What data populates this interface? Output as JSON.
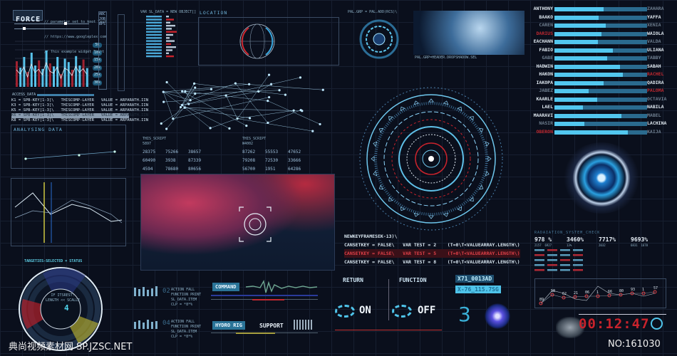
{
  "force": {
    "title": "FORCE",
    "notes": [
      "// parameter set to knot Test",
      "// https://www.googleplex.com",
      "// This example widget Right"
    ],
    "side_tags": [
      "ABC",
      "JOB",
      "BPS"
    ],
    "buttons": [
      "5k",
      "10k",
      "15k",
      "20k",
      "25k",
      "30k"
    ],
    "bars": [
      0.6,
      0.45,
      0.7,
      0.35,
      0.8,
      0.5,
      0.62,
      0.42,
      0.85,
      0.55,
      0.48,
      0.7,
      0.3,
      0.66,
      0.58,
      0.4,
      0.72,
      0.5,
      0.64,
      0.44
    ]
  },
  "access": {
    "title": "ACCESS_DATA",
    "rows": [
      "K1 = SPB-KEY[1-3]\\   THISCOMP-LAYER   VALUE = ARPARATH.IIN",
      "K3 = SPB-KEY[1-3]\\   THISCOMP-LAYER   VALUE = ARPARATH.IIN",
      "K5 = SPB-KEY[1-3]\\   THISCOMP-LAYER   VALUE = ARPARATH.IIN",
      "K6 = SPB-KEY[1-3]\\   THISCOMP-LAYER   VALUE = ARPARATH.IIN",
      "K8 = SPB-KEY[1-3]\\   THISCOMP-LAYER   VALUE = ARPARATH.IIN"
    ],
    "highlight_row": 3
  },
  "analysing": {
    "title": "ANALYSING DATA"
  },
  "var_panel": {
    "title": "VAR SL_DATA = NEW OBJECT[]"
  },
  "location": {
    "title": "LOCATION"
  },
  "pal": {
    "title": "PAL.GRP = PAL.ADD(RCS)\\",
    "caption": "PAL.GRP=HEADER.DROPSHADOW.SEL"
  },
  "names": [
    {
      "left": "ANTHONY",
      "right": "ZAHARA",
      "fill": 0.53,
      "ls": "n",
      "rs": "d"
    },
    {
      "left": "BAAKO",
      "right": "YAFFA",
      "fill": 0.48,
      "ls": "n",
      "rs": "n"
    },
    {
      "left": "CAREN",
      "right": "XENIA",
      "fill": 0.55,
      "ls": "d",
      "rs": "d"
    },
    {
      "left": "DARIUS",
      "right": "WAIOLA",
      "fill": 0.51,
      "ls": "r",
      "rs": "n"
    },
    {
      "left": "EACHANN",
      "right": "VALDA",
      "fill": 0.47,
      "ls": "n",
      "rs": "d"
    },
    {
      "left": "FABIO",
      "right": "ULIANA",
      "fill": 0.63,
      "ls": "n",
      "rs": "n"
    },
    {
      "left": "GABE",
      "right": "TABBY",
      "fill": 0.57,
      "ls": "d",
      "rs": "d"
    },
    {
      "left": "HADWIN",
      "right": "SABAH",
      "fill": 0.71,
      "ls": "n",
      "rs": "n"
    },
    {
      "left": "HAKON",
      "right": "RACHEL",
      "fill": 0.74,
      "ls": "n",
      "rs": "r"
    },
    {
      "left": "IAKOPA",
      "right": "QADIRA",
      "fill": 0.53,
      "ls": "n",
      "rs": "n"
    },
    {
      "left": "JABEZ",
      "right": "PALOMA",
      "fill": 0.37,
      "ls": "d",
      "rs": "r"
    },
    {
      "left": "KAARLE",
      "right": "OCTAVIA",
      "fill": 0.46,
      "ls": "n",
      "rs": "d"
    },
    {
      "left": "LAEL",
      "right": "NABILA",
      "fill": 0.31,
      "ls": "n",
      "rs": "n"
    },
    {
      "left": "MAARAVI",
      "right": "MABEL",
      "fill": 0.72,
      "ls": "n",
      "rs": "d"
    },
    {
      "left": "NASIR",
      "right": "LACHINA",
      "fill": 0.32,
      "ls": "d",
      "rs": "n"
    },
    {
      "left": "OBERON",
      "right": "KAIJA",
      "fill": 0.79,
      "ls": "r",
      "rs": "d"
    }
  ],
  "scripts": {
    "left_label": "THIS_SCRIPT\n5897",
    "right_label": "THIS_SCRIPT\nW4002",
    "rows": [
      [
        "28375",
        "75266",
        "38657",
        "87262",
        "55553",
        "47652"
      ],
      [
        "60490",
        "3938",
        "87339",
        "79208",
        "72530",
        "33666"
      ],
      [
        "4594",
        "78680",
        "80656",
        "56700",
        "1951",
        "64286"
      ]
    ]
  },
  "code": {
    "lines": [
      "NEWKEYFRAMESEK-13)\\",
      "CANSETKEY = FALSE\\   VAR TEST = 2    (T=0\\T<VALUEARRAY.LENGTH\\)",
      "CANSETKEY = FALSE\\   VAR TEST = 5    (T=0\\T<VALUEARRAY.LENGTH\\)",
      "CANSETKEY = FALSE\\   VAR TEST = 8    (T=0\\T<VALUEARRAY.LENGTH\\)"
    ],
    "highlight_line": 2
  },
  "controls": {
    "return_label": "RETURN",
    "function_label": "FUNCTION",
    "on_label": "ON",
    "off_label": "OFF",
    "digit": "3"
  },
  "coords": {
    "primary": "X71_0013AD",
    "secondary": "X-76_115.7SG"
  },
  "radiation": {
    "title": "RADAIATION_SYSTEM_CHECK",
    "values": [
      "978 %",
      "3460%",
      "7717%",
      "9693%"
    ],
    "subvalues": [
      "2157  6927",
      "13%",
      "2032",
      "6831  1678"
    ]
  },
  "right_chart": {
    "labels": [
      "89",
      "58",
      "62",
      "21",
      "06",
      "1",
      "66",
      "80",
      "93",
      "1",
      "57"
    ]
  },
  "timer": {
    "value": "00:12:47"
  },
  "target": {
    "title": "TARGETIES-SELECTED = STATUS",
    "inner": "IF ITSREST:\nLENGTH << SCALLE",
    "number": "4",
    "colors": {
      "red": "#b3202a",
      "yellow": "#b8b030",
      "blue": "#2b3a8a"
    }
  },
  "command": {
    "command_label": "COMMAND",
    "hydro_label": "HYDRO RIG",
    "support_label": "SUPPORT",
    "slot_a": "02",
    "slot_b": "04",
    "slot_text": "ACTION FALL\nFUNCTION PRINT\nSL_DATA.ITEM\nCLP = *8*%"
  },
  "watermark": {
    "left": "典尚视频素材网 SP.JZSC.NET",
    "right": "NO:161030"
  },
  "colors": {
    "accent": "#52c7ef",
    "red": "#c8232c",
    "panel": "#3a4b63"
  }
}
